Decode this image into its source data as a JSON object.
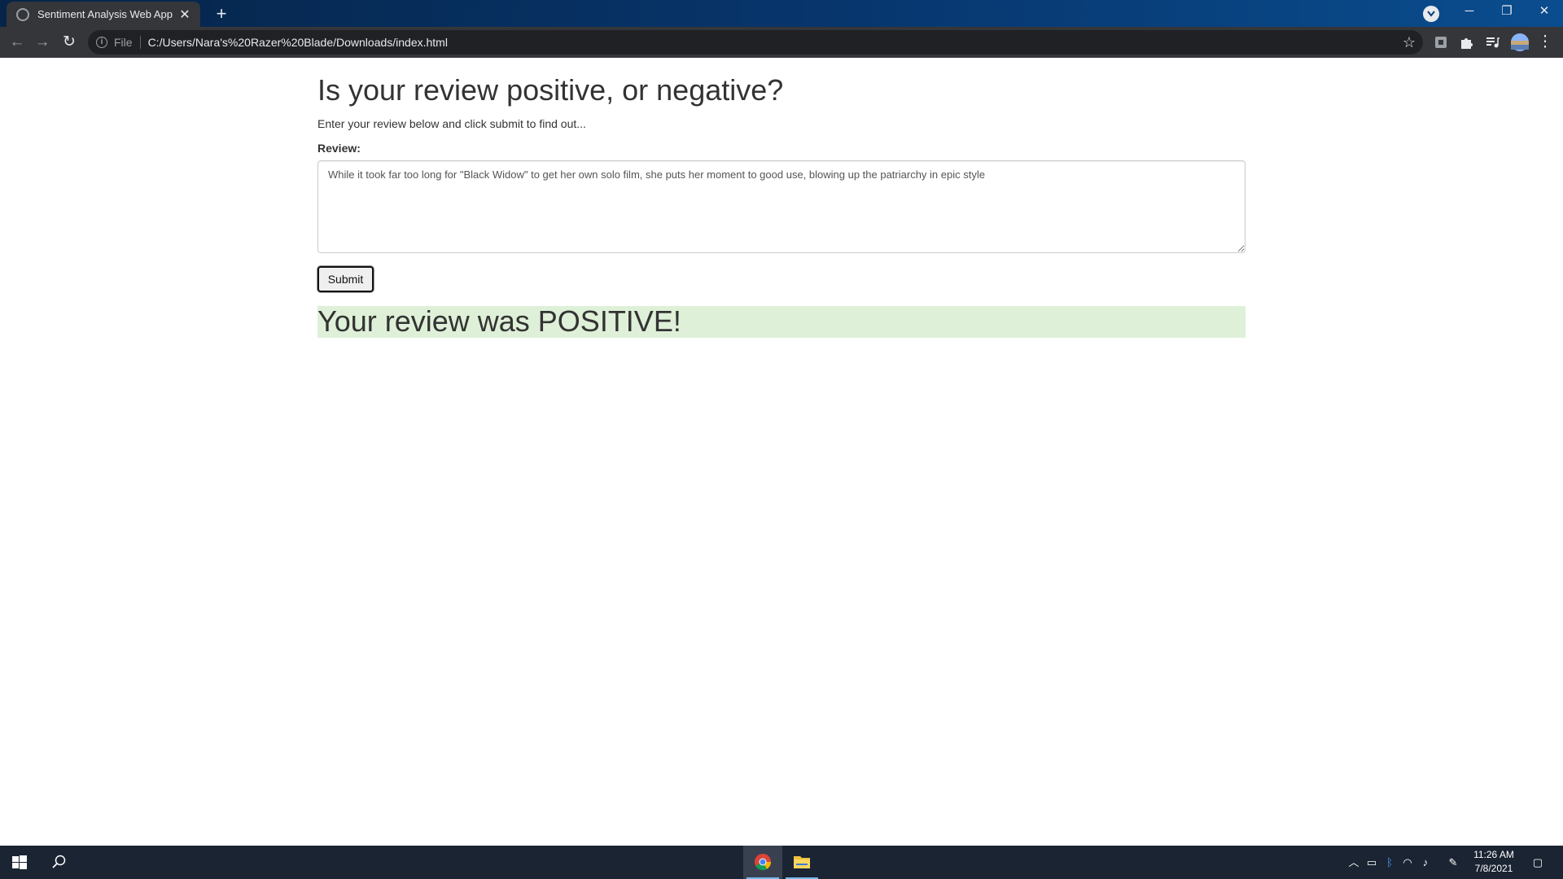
{
  "browser": {
    "tab_title": "Sentiment Analysis Web App",
    "address_scheme": "File",
    "address_url": "C:/Users/Nara's%20Razer%20Blade/Downloads/index.html"
  },
  "page": {
    "heading": "Is your review positive, or negative?",
    "instructions": "Enter your review below and click submit to find out...",
    "review_label": "Review:",
    "review_text": "While it took far too long for \"Black Widow\" to get her own solo film, she puts her moment to good use, blowing up the patriarchy in epic style",
    "submit_label": "Submit",
    "result_text": "Your review was POSITIVE!"
  },
  "taskbar": {
    "time": "11:26 AM",
    "date": "7/8/2021"
  },
  "colors": {
    "result_background": "#dff0d8",
    "tab_strip": "#07366e",
    "toolbar": "#35363a",
    "taskbar": "#1b2432"
  }
}
